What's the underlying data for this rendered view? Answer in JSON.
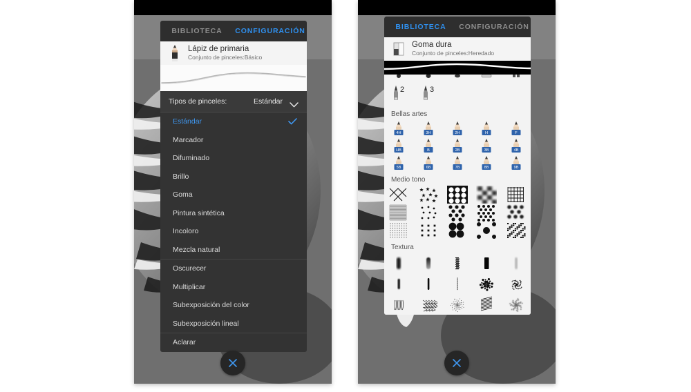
{
  "background_color": "#ffffff",
  "accent_color": "#2f90ef",
  "phones": {
    "left": {
      "name": "settings-phone",
      "tabs": [
        {
          "label": "BIBLIOTECA",
          "active": false
        },
        {
          "label": "CONFIGURACIÓN",
          "active": true
        }
      ],
      "brush_header": {
        "icon": "pencil-icon",
        "title": "Lápiz de primaria",
        "subtitle": "Conjunto de pinceles:Básico"
      },
      "row_header": {
        "label": "Tipos de pinceles:",
        "value": "Estándar",
        "icon": "chevron-down-icon"
      },
      "menu_items": [
        {
          "label": "Estándar",
          "selected": true,
          "group_start": false
        },
        {
          "label": "Marcador",
          "selected": false,
          "group_start": false
        },
        {
          "label": "Difuminado",
          "selected": false,
          "group_start": false
        },
        {
          "label": "Brillo",
          "selected": false,
          "group_start": false
        },
        {
          "label": "Goma",
          "selected": false,
          "group_start": false
        },
        {
          "label": "Pintura sintética",
          "selected": false,
          "group_start": false
        },
        {
          "label": "Incoloro",
          "selected": false,
          "group_start": false
        },
        {
          "label": "Mezcla natural",
          "selected": false,
          "group_start": false
        },
        {
          "label": "Oscurecer",
          "selected": false,
          "group_start": true
        },
        {
          "label": "Multiplicar",
          "selected": false,
          "group_start": false
        },
        {
          "label": "Subexposición del color",
          "selected": false,
          "group_start": false
        },
        {
          "label": "Subexposición lineal",
          "selected": false,
          "group_start": false
        },
        {
          "label": "Aclarar",
          "selected": false,
          "group_start": true
        }
      ],
      "close_button": {
        "icon": "close-icon",
        "label": "✕"
      }
    },
    "right": {
      "name": "library-phone",
      "tabs": [
        {
          "label": "BIBLIOTECA",
          "active": true
        },
        {
          "label": "CONFIGURACIÓN",
          "active": false
        }
      ],
      "brush_header": {
        "icon": "eraser-icon",
        "title": "Goma dura",
        "subtitle": "Conjunto de pinceles:Heredado"
      },
      "pen_row_labels": [
        "2",
        "3"
      ],
      "sections": [
        {
          "title": "Bellas artes",
          "type": "pencil-grid",
          "items": [
            "4H",
            "3H",
            "2H",
            "H",
            "F",
            "HB",
            "B",
            "2B",
            "3B",
            "4B",
            "5B",
            "6B",
            "7B",
            "8B",
            "9B"
          ]
        },
        {
          "title": "Medio tono",
          "type": "pattern-grid",
          "items": [
            "crosshatch-diamond",
            "stars",
            "circle-mesh",
            "blur-check",
            "fine-grid",
            "dense-grid",
            "sparse-dots",
            "dot-check",
            "diag-dot-check",
            "soft-dot-check",
            "micro-dots",
            "square-dots",
            "big-circles",
            "dot-ring",
            "weave-noise"
          ]
        },
        {
          "title": "Textura",
          "type": "texture-grid",
          "items": [
            "soft-bar",
            "gradient-bar",
            "rough-bar",
            "hard-bar",
            "light-bar",
            "thin-bar",
            "sharp-bar",
            "dotted-line",
            "splatter",
            "speckle",
            "hatch-brush",
            "scribble",
            "stipple",
            "diagonal-hatch",
            "smudge"
          ]
        }
      ],
      "close_button": {
        "icon": "close-icon",
        "label": "✕"
      }
    }
  }
}
